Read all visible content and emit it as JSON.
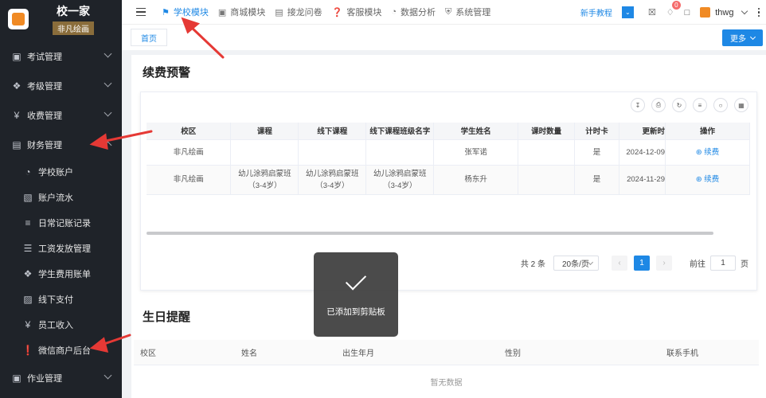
{
  "brand": {
    "title": "校一家",
    "tag": "非凡绘画",
    "logo_text": "校一家"
  },
  "sidebar": {
    "items": [
      {
        "label": "考试管理",
        "icon": "briefcase-icon"
      },
      {
        "label": "考级管理",
        "icon": "tag-icon"
      },
      {
        "label": "收费管理",
        "icon": "yen-icon"
      },
      {
        "label": "财务管理",
        "icon": "ledger-icon"
      }
    ],
    "finance_sub": [
      {
        "label": "学校账户",
        "icon": "dashboard-icon"
      },
      {
        "label": "账户流水",
        "icon": "bank-icon"
      },
      {
        "label": "日常记账记录",
        "icon": "sliders-icon"
      },
      {
        "label": "工资发放管理",
        "icon": "list-icon"
      },
      {
        "label": "学生费用账单",
        "icon": "tag-icon"
      },
      {
        "label": "线下支付",
        "icon": "wallet-icon"
      },
      {
        "label": "员工收入",
        "icon": "yen-icon"
      },
      {
        "label": "微信商户后台",
        "icon": "alert-icon"
      }
    ],
    "last_item": {
      "label": "作业管理",
      "icon": "briefcase-icon"
    }
  },
  "header": {
    "nav": [
      {
        "label": "学校模块",
        "icon": "flag-icon",
        "active": true
      },
      {
        "label": "商城模块",
        "icon": "shop-icon",
        "active": false
      },
      {
        "label": "接龙问卷",
        "icon": "clipboard-icon",
        "active": false
      },
      {
        "label": "客服模块",
        "icon": "help-icon",
        "active": false
      },
      {
        "label": "数据分析",
        "icon": "chart-icon",
        "active": false
      },
      {
        "label": "系统管理",
        "icon": "shield-icon",
        "active": false
      }
    ],
    "tutorial": "新手教程",
    "notification_count": "0",
    "username": "thwg"
  },
  "tabs": {
    "home": "首页",
    "more": "更多"
  },
  "renewal": {
    "title": "续费预警",
    "columns": [
      "校区",
      "课程",
      "线下课程",
      "线下课程班级名字",
      "学生姓名",
      "课时数量",
      "计时卡",
      "更新时",
      "操作"
    ],
    "rows": [
      {
        "campus": "非凡绘画",
        "course": "",
        "offline": "",
        "class_name": "",
        "student": "张军诺",
        "hours": "",
        "timer": "是",
        "updated": "2024-12-09",
        "action": "续费"
      },
      {
        "campus": "非凡绘画",
        "course": "幼儿涂鸦启蒙班（3-4岁）",
        "offline": "幼儿涂鸦启蒙班（3-4岁）",
        "class_name": "幼儿涂鸦启蒙班（3-4岁）",
        "student": "杨东升",
        "hours": "",
        "timer": "是",
        "updated": "2024-11-29",
        "action": "续费"
      }
    ],
    "pager": {
      "total": "共 2 条",
      "page_size": "20条/页",
      "current": "1",
      "goto_label": "前往",
      "goto_value": "1",
      "page_suffix": "页"
    }
  },
  "birthday": {
    "title": "生日提醒",
    "columns": [
      "校区",
      "姓名",
      "出生年月",
      "性别",
      "联系手机"
    ],
    "empty": "暂无数据"
  },
  "toast": {
    "message": "已添加到剪贴板"
  },
  "colors": {
    "primary": "#1e88e5",
    "sidebar": "#1f2329",
    "annotation": "#e53935"
  }
}
